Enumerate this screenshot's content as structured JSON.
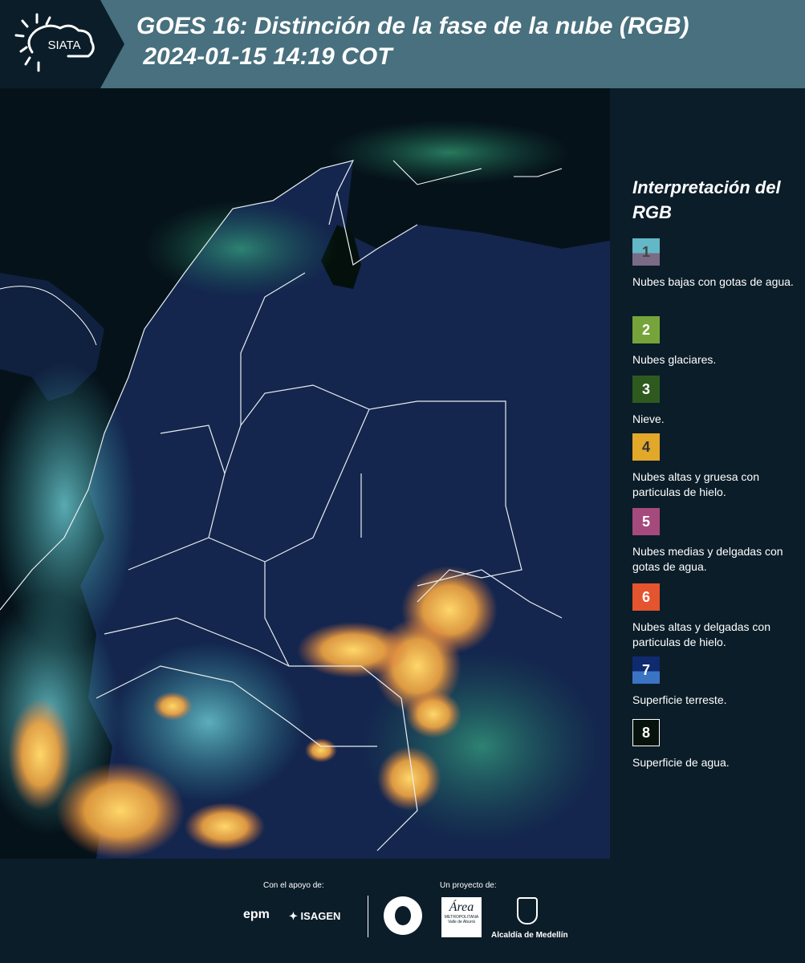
{
  "header": {
    "brand": "SIATA",
    "title": "GOES 16: Distinción de la fase de la nube (RGB)\n 2024-01-15 14:19 COT"
  },
  "legend": {
    "title": "Interpretación del RGB",
    "items": [
      {
        "num": "1",
        "label": "Nubes bajas con gotas de agua.",
        "top_color": "#63b8c7",
        "bottom_color": "#7a6b86",
        "num_color": "#444444"
      },
      {
        "num": "2",
        "label": "Nubes glaciares.",
        "top_color": "#77a43a",
        "bottom_color": "#77a43a",
        "num_color": "#ffffff"
      },
      {
        "num": "3",
        "label": "Nieve.",
        "top_color": "#2e5a1f",
        "bottom_color": "#2e5a1f",
        "num_color": "#ffffff"
      },
      {
        "num": "4",
        "label": "Nubes altas y gruesa con particulas de hielo.",
        "top_color": "#e1a82a",
        "bottom_color": "#e1a82a",
        "num_color": "#333333"
      },
      {
        "num": "5",
        "label": "Nubes medias y delgadas con gotas de agua.",
        "top_color": "#a54a7c",
        "bottom_color": "#a54a7c",
        "num_color": "#ffffff"
      },
      {
        "num": "6",
        "label": "Nubes altas y delgadas con particulas de hielo.",
        "top_color": "#e4542e",
        "bottom_color": "#e4542e",
        "num_color": "#ffffff"
      },
      {
        "num": "7",
        "label": "Superficie terreste.",
        "top_color": "#0f2a6e",
        "bottom_color": "#3c74c4",
        "num_color": "#ffffff"
      },
      {
        "num": "8",
        "label": "Superficie de agua.",
        "top_color": "#06120b",
        "bottom_color": "#06120b",
        "num_color": "#ffffff"
      }
    ]
  },
  "footer": {
    "support_label": "Con el apoyo de:",
    "project_label": "Un proyecto de:",
    "sponsor1": "epm",
    "sponsor2": "ISAGEN",
    "partner1": "Área",
    "partner1_sub": "METROPOLITANA",
    "partner1_sub2": "Valle de Aburrá",
    "partner2": "Alcaldía de Medellín"
  }
}
